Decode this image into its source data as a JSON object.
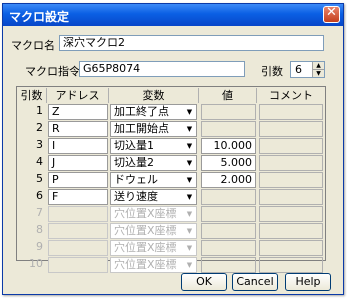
{
  "window": {
    "title": "マクロ設定",
    "close_glyph": "✕"
  },
  "macro_name": {
    "label": "マクロ名",
    "value": "深穴マクロ2"
  },
  "macro_command": {
    "label": "マクロ指令",
    "value": "G65P8074"
  },
  "arg_count": {
    "label": "引数",
    "value": "6"
  },
  "table": {
    "headers": [
      "引数",
      "アドレス",
      "変数",
      "値",
      "コメント"
    ],
    "rows": [
      {
        "num": "1",
        "address": "Z",
        "variable": "加工終了点",
        "value": "",
        "enabled": true
      },
      {
        "num": "2",
        "address": "R",
        "variable": "加工開始点",
        "value": "",
        "enabled": true
      },
      {
        "num": "3",
        "address": "I",
        "variable": "切込量1",
        "value": "10.000",
        "enabled": true
      },
      {
        "num": "4",
        "address": "J",
        "variable": "切込量2",
        "value": "5.000",
        "enabled": true
      },
      {
        "num": "5",
        "address": "P",
        "variable": "ドウェル",
        "value": "2.000",
        "enabled": true
      },
      {
        "num": "6",
        "address": "F",
        "variable": "送り速度",
        "value": "",
        "enabled": true
      },
      {
        "num": "7",
        "address": "",
        "variable": "穴位置X座標",
        "value": "",
        "enabled": false
      },
      {
        "num": "8",
        "address": "",
        "variable": "穴位置X座標",
        "value": "",
        "enabled": false
      },
      {
        "num": "9",
        "address": "",
        "variable": "穴位置X座標",
        "value": "",
        "enabled": false
      },
      {
        "num": "10",
        "address": "",
        "variable": "穴位置X座標",
        "value": "",
        "enabled": false
      }
    ]
  },
  "buttons": {
    "ok": "OK",
    "cancel": "Cancel",
    "help": "Help"
  }
}
